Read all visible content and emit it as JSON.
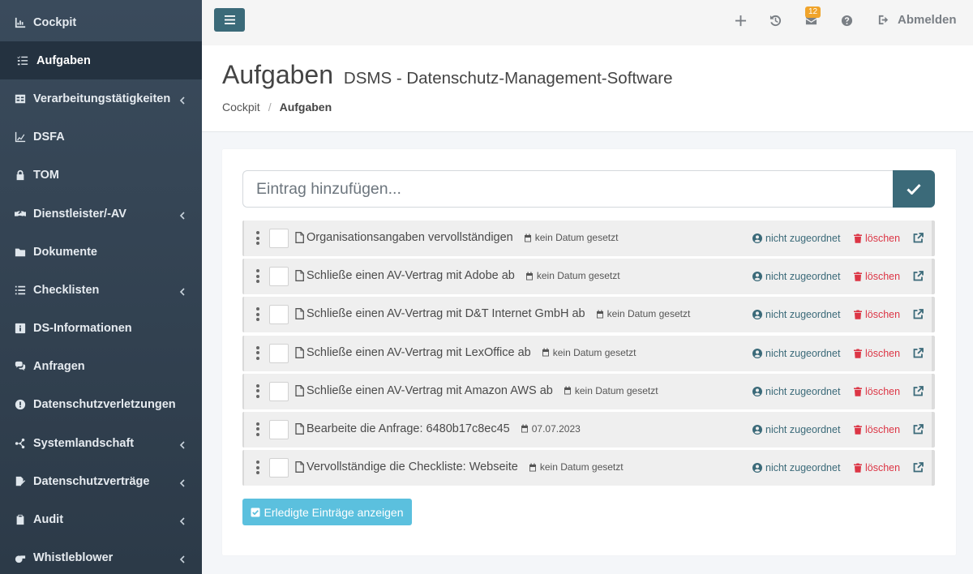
{
  "sidebar": {
    "items": [
      {
        "label": "Cockpit",
        "icon": "chart-line-icon",
        "active": false,
        "has_submenu": false
      },
      {
        "label": "Aufgaben",
        "icon": "tasks-list-icon",
        "active": true,
        "has_submenu": false
      },
      {
        "label": "Verarbeitungstätigkeiten",
        "icon": "table-icon",
        "active": false,
        "has_submenu": true
      },
      {
        "label": "DSFA",
        "icon": "chart-area-icon",
        "active": false,
        "has_submenu": false
      },
      {
        "label": "TOM",
        "icon": "lock-icon",
        "active": false,
        "has_submenu": false
      },
      {
        "label": "Dienstleister/-AV",
        "icon": "handshake-icon",
        "active": false,
        "has_submenu": true
      },
      {
        "label": "Dokumente",
        "icon": "folder-icon",
        "active": false,
        "has_submenu": false
      },
      {
        "label": "Checklisten",
        "icon": "list-icon",
        "active": false,
        "has_submenu": true
      },
      {
        "label": "DS-Informationen",
        "icon": "info-square-icon",
        "active": false,
        "has_submenu": false
      },
      {
        "label": "Anfragen",
        "icon": "comments-icon",
        "active": false,
        "has_submenu": false
      },
      {
        "label": "Datenschutzverletzungen",
        "icon": "exclamation-circle-icon",
        "active": false,
        "has_submenu": false
      },
      {
        "label": "Systemlandschaft",
        "icon": "network-icon",
        "active": false,
        "has_submenu": true
      },
      {
        "label": "Datenschutzverträge",
        "icon": "file-signature-icon",
        "active": false,
        "has_submenu": true
      },
      {
        "label": "Audit",
        "icon": "clipboard-icon",
        "active": false,
        "has_submenu": true
      },
      {
        "label": "Whistleblower",
        "icon": "whistle-icon",
        "active": false,
        "has_submenu": true
      }
    ]
  },
  "topbar": {
    "notification_count": "12",
    "logout_label": "Abmelden"
  },
  "header": {
    "title": "Aufgaben",
    "subtitle": "DSMS - Datenschutz-Management-Software",
    "breadcrumb": {
      "home": "Cockpit",
      "current": "Aufgaben"
    }
  },
  "main": {
    "add_placeholder": "Eintrag hinzufügen...",
    "tasks": [
      {
        "title": "Organisationsangaben vervollständigen",
        "date": "kein Datum gesetzt",
        "assignee": "nicht zugeordnet",
        "delete_label": "löschen"
      },
      {
        "title": "Schließe einen AV-Vertrag mit Adobe ab",
        "date": "kein Datum gesetzt",
        "assignee": "nicht zugeordnet",
        "delete_label": "löschen"
      },
      {
        "title": "Schließe einen AV-Vertrag mit D&T Internet GmbH ab",
        "date": "kein Datum gesetzt",
        "assignee": "nicht zugeordnet",
        "delete_label": "löschen"
      },
      {
        "title": "Schließe einen AV-Vertrag mit LexOffice ab",
        "date": "kein Datum gesetzt",
        "assignee": "nicht zugeordnet",
        "delete_label": "löschen"
      },
      {
        "title": "Schließe einen AV-Vertrag mit Amazon AWS ab",
        "date": "kein Datum gesetzt",
        "assignee": "nicht zugeordnet",
        "delete_label": "löschen"
      },
      {
        "title": "Bearbeite die Anfrage: 6480b17c8ec45",
        "date": "07.07.2023",
        "assignee": "nicht zugeordnet",
        "delete_label": "löschen"
      },
      {
        "title": "Vervollständige die Checkliste: Webseite",
        "date": "kein Datum gesetzt",
        "assignee": "nicht zugeordnet",
        "delete_label": "löschen"
      }
    ],
    "show_done_label": "Erledigte Einträge anzeigen"
  },
  "colors": {
    "sidebar_bg": "#34495e",
    "accent": "#3b6a79",
    "danger": "#dc3545",
    "info_button": "#5bc0de",
    "badge": "#f0a42b"
  }
}
